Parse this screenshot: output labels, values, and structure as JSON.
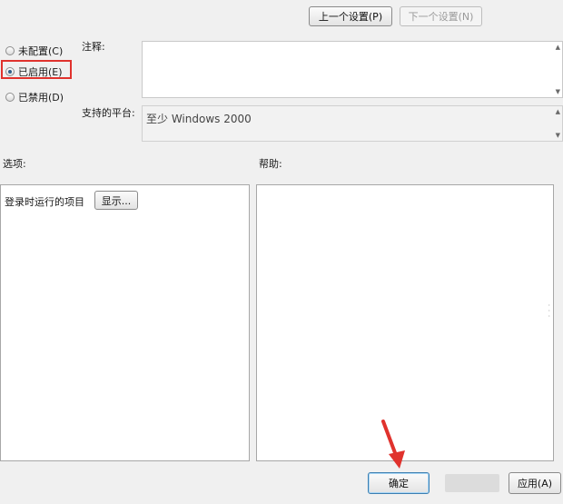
{
  "nav": {
    "prev_setting": "上一个设置(P)",
    "next_setting": "下一个设置(N)"
  },
  "state": {
    "options": [
      {
        "label": "未配置(C)",
        "checked": false
      },
      {
        "label": "已启用(E)",
        "checked": true
      },
      {
        "label": "已禁用(D)",
        "checked": false
      }
    ]
  },
  "comment": {
    "label": "注释:",
    "value": ""
  },
  "platform": {
    "label": "支持的平台:",
    "value": "至少 Windows 2000"
  },
  "options_panel": {
    "label": "选项:",
    "item_label": "登录时运行的项目",
    "show_button": "显示..."
  },
  "help_panel": {
    "label": "帮助:"
  },
  "footer": {
    "ok": "确定",
    "apply": "应用(A)"
  },
  "colors": {
    "highlight_box": "#e0322d",
    "annotation_arrow": "#e0322d"
  }
}
